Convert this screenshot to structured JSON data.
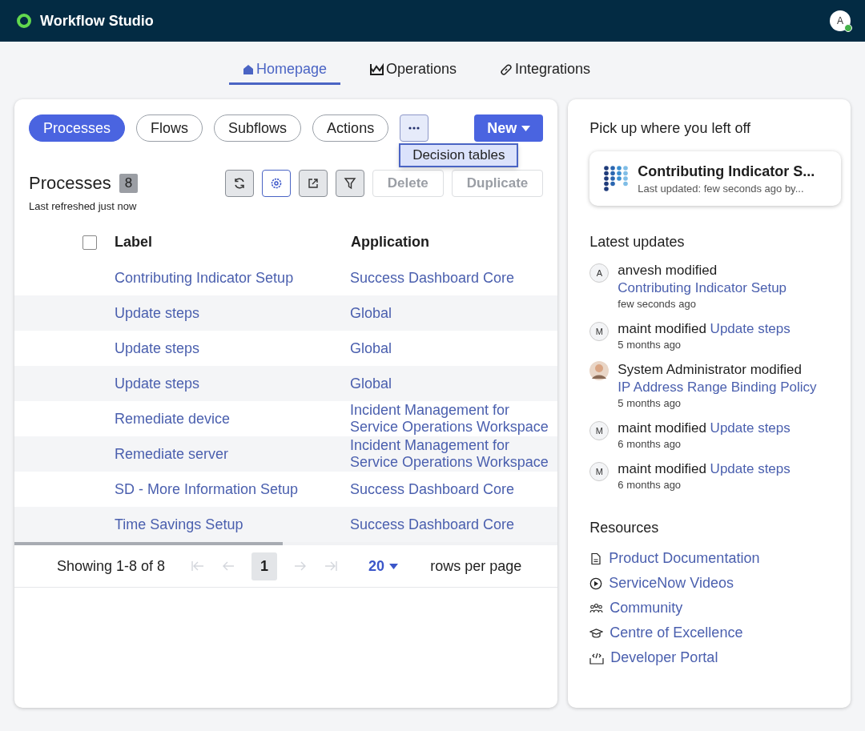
{
  "app": {
    "title": "Workflow Studio",
    "user_initial": "A",
    "user_online": true
  },
  "nav_tabs": [
    {
      "label": "Homepage",
      "kind": "home",
      "selected": true
    },
    {
      "label": "Operations",
      "kind": "chart",
      "selected": false
    },
    {
      "label": "Integrations",
      "kind": "link",
      "selected": false
    }
  ],
  "filters": [
    {
      "label": "Processes",
      "selected": true
    },
    {
      "label": "Flows",
      "selected": false
    },
    {
      "label": "Subflows",
      "selected": false
    },
    {
      "label": "Actions",
      "selected": false
    }
  ],
  "more_menu": {
    "expanded": true,
    "items": [
      {
        "label": "Decision tables",
        "selected": true
      }
    ]
  },
  "new_button": {
    "label": "New"
  },
  "list": {
    "title": "Processes",
    "count": "8",
    "refreshed": "Last refreshed just now",
    "actions": [
      {
        "label": "Delete",
        "disabled": true
      },
      {
        "label": "Duplicate",
        "disabled": true
      }
    ]
  },
  "table": {
    "select_all": {
      "checked": false
    },
    "columns": [
      "Label",
      "Application"
    ],
    "rows": [
      {
        "label": "Contributing Indicator Setup",
        "application": "Success Dashboard Core"
      },
      {
        "label": "Update steps",
        "application": "Global"
      },
      {
        "label": "Update steps",
        "application": "Global"
      },
      {
        "label": "Update steps",
        "application": "Global"
      },
      {
        "label": "Remediate device",
        "application": "Incident Management for Service Operations Workspace"
      },
      {
        "label": "Remediate server",
        "application": "Incident Management for Service Operations Workspace"
      },
      {
        "label": "SD - More Information Setup",
        "application": "Success Dashboard Core"
      },
      {
        "label": "Time Savings Setup",
        "application": "Success Dashboard Core"
      }
    ]
  },
  "pagination": {
    "summary": "Showing 1-8 of 8",
    "page": "1",
    "page_size": "20",
    "page_size_label": "rows per page"
  },
  "pickup": {
    "title": "Pick up where you left off",
    "card_title": "Contributing Indicator S...",
    "card_subtitle": "Last updated: few seconds ago by..."
  },
  "updates": {
    "title": "Latest updates",
    "items": [
      {
        "kind": "initial",
        "initial": "A",
        "actor": "anvesh modified",
        "link": "Contributing Indicator Setup",
        "time": "few seconds ago"
      },
      {
        "kind": "initial",
        "initial": "M",
        "actor": "maint modified",
        "link": "Update steps",
        "time": "5 months ago"
      },
      {
        "kind": "photo",
        "actor": "System Administrator modified",
        "link": "IP Address Range Binding Policy",
        "time": "5 months ago"
      },
      {
        "kind": "initial",
        "initial": "M",
        "actor": "maint modified",
        "link": "Update steps",
        "time": "6 months ago"
      },
      {
        "kind": "initial",
        "initial": "M",
        "actor": "maint modified",
        "link": "Update steps",
        "time": "6 months ago"
      }
    ]
  },
  "resources": {
    "title": "Resources",
    "items": [
      {
        "label": "Product Documentation",
        "kind": "doc"
      },
      {
        "label": "ServiceNow Videos",
        "kind": "video"
      },
      {
        "label": "Community",
        "kind": "community"
      },
      {
        "label": "Centre of Excellence",
        "kind": "education"
      },
      {
        "label": "Developer Portal",
        "kind": "developer"
      }
    ]
  }
}
